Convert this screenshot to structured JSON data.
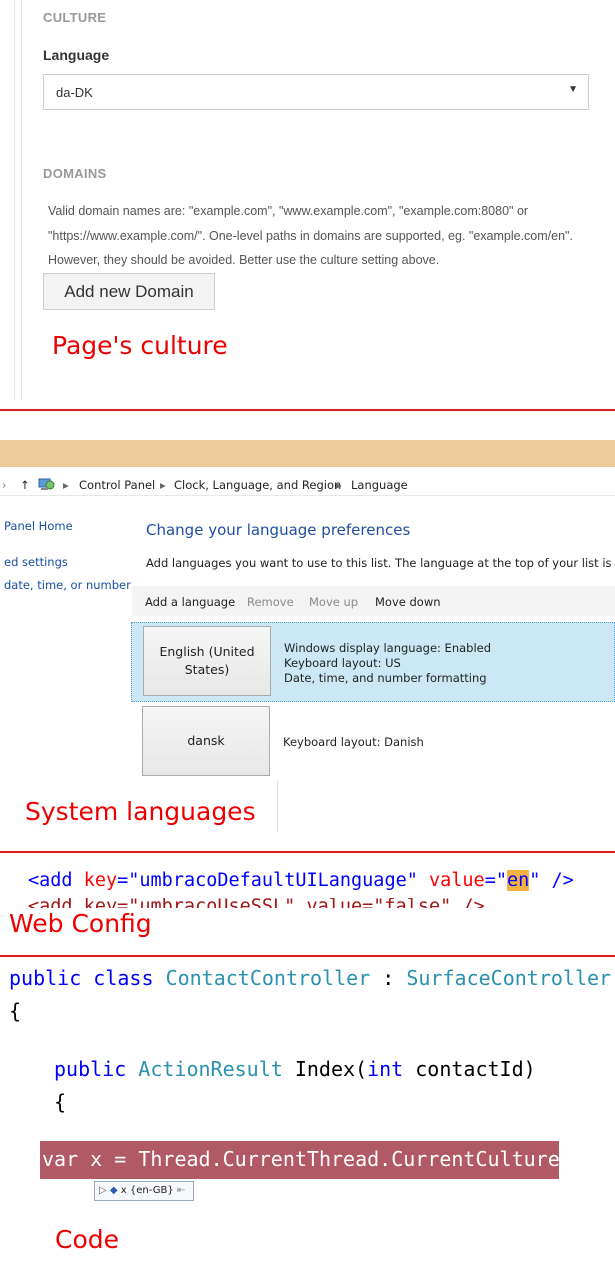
{
  "umbraco": {
    "culture_heading": "CULTURE",
    "language_label": "Language",
    "language_value": "da-DK",
    "domains_heading": "DOMAINS",
    "domains_help": [
      "Valid domain names are: \"example.com\", \"www.example.com\", \"example.com:8080\" or",
      "\"https://www.example.com/\". One-level paths in domains are supported, eg. \"example.com/en\".",
      "However, they should be avoided. Better use the culture setting above."
    ],
    "add_domain_button": "Add new Domain"
  },
  "captions": {
    "page_culture": "Page's culture",
    "system_languages": "System languages",
    "web_config": "Web Config",
    "code": "Code"
  },
  "control_panel": {
    "breadcrumb": [
      "Control Panel",
      "Clock, Language, and Region",
      "Language"
    ],
    "sidebar": [
      "Panel Home",
      "ed settings",
      "date, time, or number"
    ],
    "title": "Change your language preferences",
    "subtitle": "Add languages you want to use to this list. The language at the top of your list is your pri",
    "toolbar": {
      "add": "Add a language",
      "remove": "Remove",
      "move_up": "Move up",
      "move_down": "Move down"
    },
    "languages": [
      {
        "name_line1": "English (United",
        "name_line2": "States)",
        "info": [
          "Windows display language: Enabled",
          "Keyboard layout: US",
          "Date, time, and number formatting"
        ]
      },
      {
        "name_line1": "dansk",
        "info": [
          "Keyboard layout: Danish"
        ]
      }
    ]
  },
  "web_config": {
    "open": "<add ",
    "attr_key": "key",
    "eq": "=",
    "key_value": "\"umbracoDefaultUILanguage\"",
    "attr_value": "value",
    "value_quote": "\"",
    "value": "en",
    "close": " />",
    "cut_line": "<add key=\"umbracoUseSSL\" value=\"false\" />"
  },
  "code": {
    "l1_kw1": "public",
    "l1_kw2": "class",
    "l1_type": "ContactController",
    "l1_colon": " : ",
    "l1_base": "SurfaceController",
    "brace_open": "{",
    "l2_kw": "public",
    "l2_type": "ActionResult",
    "l2_name": "Index(",
    "l2_kw2": "int",
    "l2_param": "contactId)",
    "brace_open2": "{",
    "highlight_line": "var x = Thread.CurrentThread.CurrentCulture;",
    "tooltip": "x {en-GB}"
  }
}
